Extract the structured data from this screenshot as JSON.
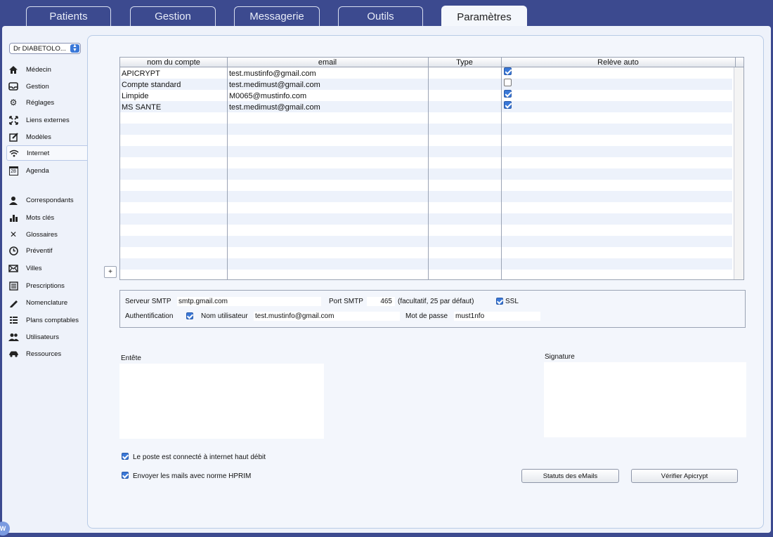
{
  "tabs": [
    "Patients",
    "Gestion",
    "Messagerie",
    "Outils",
    "Paramètres"
  ],
  "active_tab": "Paramètres",
  "sidebar": {
    "doctor": "Dr DIABETOLO...",
    "items": [
      {
        "label": "Médecin",
        "icon": "house-icon"
      },
      {
        "label": "Gestion",
        "icon": "tray-icon"
      },
      {
        "label": "Réglages",
        "icon": "gear-icon"
      },
      {
        "label": "Liens externes",
        "icon": "expand-icon"
      },
      {
        "label": "Modèles",
        "icon": "edit-icon"
      },
      {
        "label": "Internet",
        "icon": "wifi-icon"
      },
      {
        "label": "Agenda",
        "icon": "calendar-icon"
      },
      {
        "label": "Correspondants",
        "icon": "person-icon"
      },
      {
        "label": "Mots clés",
        "icon": "bar-chart-icon"
      },
      {
        "label": "Glossaires",
        "icon": "tools-icon"
      },
      {
        "label": "Préventif",
        "icon": "clock-icon"
      },
      {
        "label": "Villes",
        "icon": "mail-icon"
      },
      {
        "label": "Prescriptions",
        "icon": "list-icon"
      },
      {
        "label": "Nomenclature",
        "icon": "pen-icon"
      },
      {
        "label": "Plans comptables",
        "icon": "ledger-icon"
      },
      {
        "label": "Utilisateurs",
        "icon": "users-icon"
      },
      {
        "label": "Ressources",
        "icon": "car-icon"
      }
    ],
    "selected": "Internet",
    "calendar_day": "28"
  },
  "accounts_table": {
    "headers": [
      "nom du compte",
      "email",
      "Type",
      "Relève auto"
    ],
    "rows": [
      {
        "name": "APICRYPT",
        "email": "test.mustinfo@gmail.com",
        "type": "",
        "auto": true
      },
      {
        "name": "Compte standard",
        "email": "test.medimust@gmail.com",
        "type": "",
        "auto": false
      },
      {
        "name": "Limpide",
        "email": "M0065@mustinfo.com",
        "type": "",
        "auto": true
      },
      {
        "name": "MS SANTE",
        "email": "test.medimust@gmail.com",
        "type": "",
        "auto": true
      }
    ],
    "add_label": "+"
  },
  "smtp": {
    "server_label": "Serveur SMTP",
    "server": "smtp.gmail.com",
    "port_label": "Port SMTP",
    "port": "465",
    "port_hint": "(facultatif, 25 par défaut)",
    "ssl_label": "SSL",
    "ssl": true,
    "auth_label": "Authentification",
    "auth": true,
    "user_label": "Nom utilisateur",
    "user": "test.mustinfo@gmail.com",
    "password_label": "Mot de passe",
    "password": "must1nfo"
  },
  "entete_label": "Entête",
  "signature_label": "Signature",
  "options": [
    {
      "label": "Le poste est connecté à internet haut débit",
      "checked": true
    },
    {
      "label": "Envoyer les mails avec norme HPRIM",
      "checked": true
    }
  ],
  "buttons": {
    "status": "Statuts des eMails",
    "verify": "Vérifier Apicrypt"
  },
  "badge": "W"
}
